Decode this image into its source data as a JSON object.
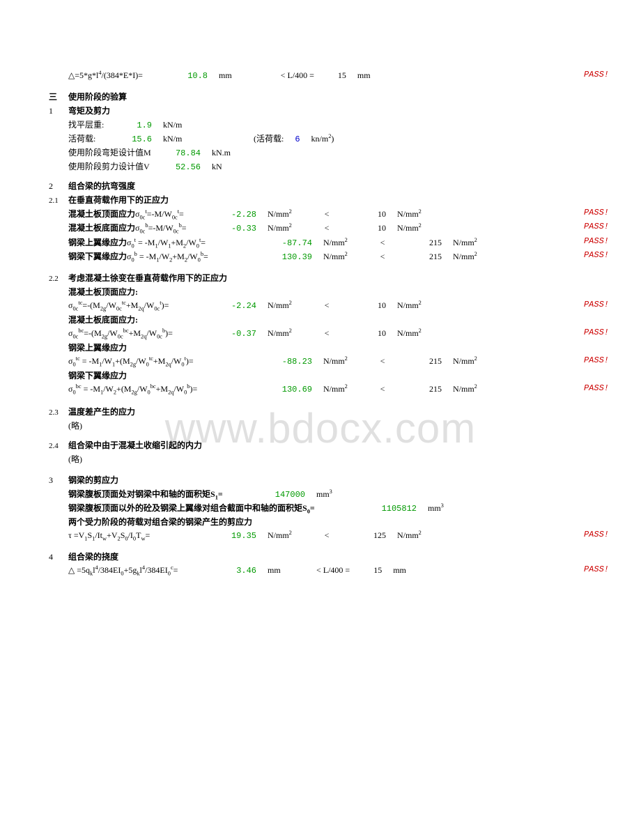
{
  "watermark": "www.bdocx.com",
  "r1": {
    "formula": "△=5*g*l⁴/(384*E*I)=",
    "val": "10.8",
    "unit": "mm",
    "cmp": "< L/400 =",
    "limit": "15",
    "limunit": "mm",
    "pass": "PASS!"
  },
  "h3": {
    "idx": "三",
    "title": "使用阶段的验算"
  },
  "s1": {
    "idx": "1",
    "title": "弯矩及剪力",
    "floor": {
      "label": "找平层重:",
      "val": "1.9",
      "unit": "kN/m"
    },
    "live": {
      "label": "活荷载:",
      "val": "15.6",
      "unit": "kN/m",
      "note_l": "(活荷载:",
      "note_v": "6",
      "note_u": "kn/m²)"
    },
    "M": {
      "label": "使用阶段弯矩设计值M",
      "val": "78.84",
      "unit": "kN.m"
    },
    "V": {
      "label": "使用阶段剪力设计值V",
      "val": "52.56",
      "unit": "kN"
    }
  },
  "s2": {
    "idx": "2",
    "title": "组合梁的抗弯强度"
  },
  "s21": {
    "idx": "2.1",
    "title": "在垂直荷载作用下的正应力",
    "a": {
      "label": "混凝土板顶面应力σ",
      "subsup": "0c t",
      "f": "=-M/W",
      "sub2": "0c t",
      "eq": "=",
      "val": "-2.28",
      "unit": "N/mm²",
      "cmp": "<",
      "lim": "10",
      "limunit": "N/mm²",
      "pass": "PASS!"
    },
    "b": {
      "label": "混凝土板底面应力σ",
      "subsup": "0c b",
      "f": "=-M/W",
      "sub2": "0c b",
      "eq": "=",
      "val": "-0.33",
      "unit": "N/mm²",
      "cmp": "<",
      "lim": "10",
      "limunit": "N/mm²",
      "pass": "PASS!"
    },
    "c": {
      "label": "钢梁上翼缘应力σ",
      "sub": "0 t",
      "f": "= -M₁/W₁+M₂/W",
      "sub2": "0 t",
      "eq": "=",
      "val": "-87.74",
      "unit": "N/mm²",
      "cmp": "<",
      "lim": "215",
      "limunit": "N/mm²",
      "pass": "PASS!"
    },
    "d": {
      "label": "钢梁下翼缘应力σ",
      "sub": "0 b",
      "f": "= -M₁/W₂+M₂/W",
      "sub2": "0 b",
      "eq": "=",
      "val": "130.39",
      "unit": "N/mm²",
      "cmp": "<",
      "lim": "215",
      "limunit": "N/mm²",
      "pass": "PASS!"
    }
  },
  "s22": {
    "idx": "2.2",
    "title": "考虑混凝土徐变在垂直荷载作用下的正应力",
    "a": {
      "label": "混凝土板顶面应力:",
      "f": "σ",
      "sub": "0c tc",
      "body": "=-(M",
      "sub2": "2g",
      "body2": "/W",
      "sub3": "0c tc",
      "body3": "+M",
      "sub4": "2q",
      "body4": "/W",
      "sub5": "0c t",
      "body5": ")=",
      "val": "-2.24",
      "unit": "N/mm²",
      "cmp": "<",
      "lim": "10",
      "limunit": "N/mm²",
      "pass": "PASS!"
    },
    "b": {
      "label": "混凝土板底面应力:",
      "f": "σ",
      "sub": "0c bc",
      "body": "=-(M",
      "sub2": "2g",
      "body2": "/W",
      "sub3": "0c bc",
      "body3": "+M",
      "sub4": "2q",
      "body4": "/W",
      "sub5": "0c b",
      "body5": ")=",
      "val": "-0.37",
      "unit": "N/mm²",
      "cmp": "<",
      "lim": "10",
      "limunit": "N/mm²",
      "pass": "PASS!"
    },
    "c": {
      "label": "钢梁上翼缘应力",
      "f": "σ",
      "sub": "0 tc",
      "body": "= -M₁/W₁+(M",
      "sub2": "2g",
      "body2": "/W",
      "sub3": "0 tc",
      "body3": "+M",
      "sub4": "2q",
      "body4": "/W",
      "sub5": "0 t",
      "body5": ")=",
      "val": "-88.23",
      "unit": "N/mm²",
      "cmp": "<",
      "lim": "215",
      "limunit": "N/mm²",
      "pass": "PASS!"
    },
    "d": {
      "label": "钢梁下翼缘应力",
      "f": "σ",
      "sub": "0 bc",
      "body": "= -M₁/W₂+(M",
      "sub2": "2g",
      "body2": "/W",
      "sub3": "0 bc",
      "body3": "+M",
      "sub4": "2q",
      "body4": "/W",
      "sub5": "0 b",
      "body5": ")=",
      "val": "130.69",
      "unit": "N/mm²",
      "cmp": "<",
      "lim": "215",
      "limunit": "N/mm²",
      "pass": "PASS!"
    }
  },
  "s23": {
    "idx": "2.3",
    "title": "温度差产生的应力",
    "note": "(略)"
  },
  "s24": {
    "idx": "2.4",
    "title": "组合梁中由于混凝土收缩引起的内力",
    "note": "(略)"
  },
  "s3": {
    "idx": "3",
    "title": "钢梁的剪应力",
    "l1": {
      "label": "钢梁腹板顶面处对钢梁中和轴的面积矩S₁=",
      "val": "147000",
      "unit": "mm³"
    },
    "l2": {
      "label": "钢梁腹板顶面以外的砼及钢梁上翼缘对组合截面中和轴的面积矩S₀=",
      "val": "1105812",
      "unit": "mm³"
    },
    "l3": {
      "label": "两个受力阶段的荷载对组合梁的钢梁产生的剪应力"
    },
    "l4": {
      "f": "τ =V₁S₁/It",
      "sub": "w",
      "f2": "+V₂S₀/I₀T",
      "sub2": "w",
      "f3": "=",
      "val": "19.35",
      "unit": "N/mm²",
      "cmp": "<",
      "lim": "125",
      "limunit": "N/mm²",
      "pass": "PASS!"
    }
  },
  "s4": {
    "idx": "4",
    "title": "组合梁的挠度",
    "l1": {
      "f": "△ =5q",
      "sub": "k",
      "f2": "l⁴/384EI₀+5g",
      "sub2": "k",
      "f3": "l⁴/384EI₀",
      "sup": "c",
      "f4": "=",
      "val": "3.46",
      "unit": "mm",
      "cmp": "< L/400 =",
      "lim": "15",
      "limunit": "mm",
      "pass": "PASS!"
    }
  }
}
